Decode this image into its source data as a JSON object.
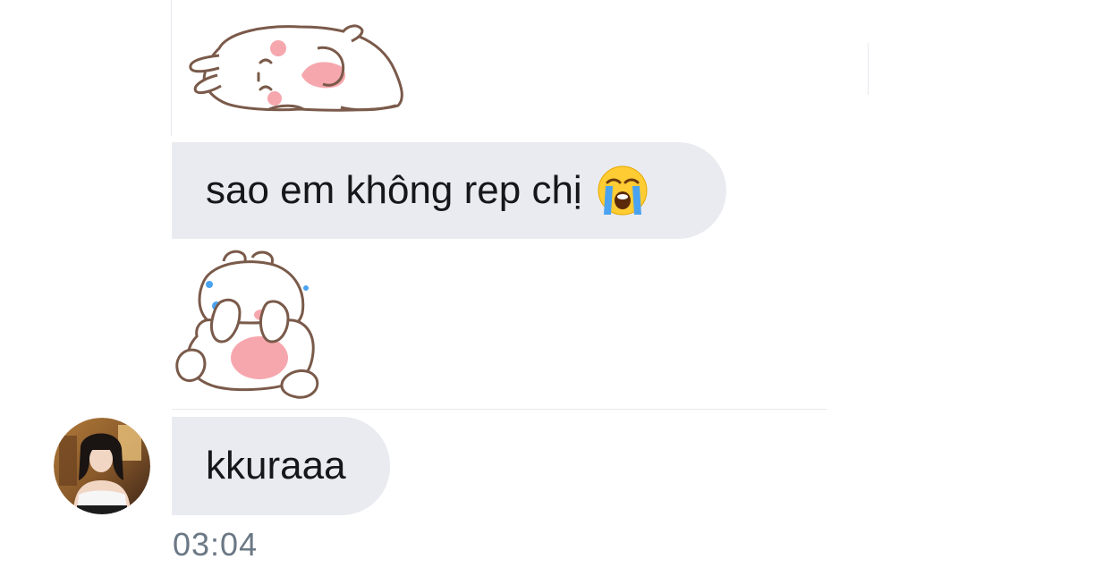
{
  "messages": [
    {
      "type": "sticker",
      "sticker_name": "sleepy-bunny-sticker"
    },
    {
      "type": "text",
      "text": "sao em không rep chị",
      "emoji": "loudly-crying-face-emoji"
    },
    {
      "type": "sticker",
      "sticker_name": "crying-bunny-sticker"
    },
    {
      "type": "text",
      "text": "kkuraaa"
    }
  ],
  "footer": {
    "timestamp": "03:04"
  },
  "colors": {
    "bubble_background": "#e9ebf0",
    "bubble_text": "#15171a",
    "timestamp_text": "#6b7885",
    "divider": "#e6e9ee",
    "sticker_outline": "#7a5a4a",
    "sticker_pink": "#f6a7ae"
  }
}
